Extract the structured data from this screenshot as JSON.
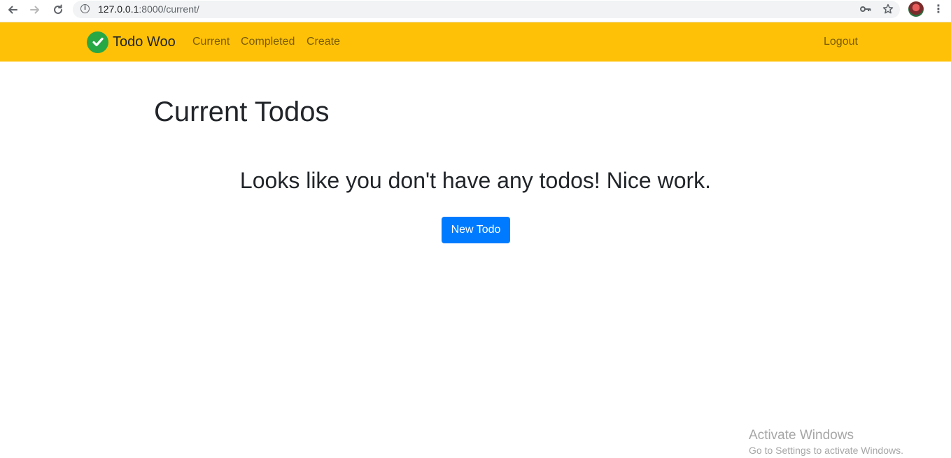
{
  "browser": {
    "url_host": "127.0.0.1",
    "url_rest": ":8000/current/",
    "icons": [
      "back-arrow-icon",
      "forward-arrow-icon",
      "reload-icon",
      "site-info-icon",
      "key-icon",
      "star-icon",
      "profile-avatar",
      "menu-dots-icon"
    ]
  },
  "navbar": {
    "brand": "Todo Woo",
    "links": [
      "Current",
      "Completed",
      "Create"
    ],
    "logout": "Logout",
    "color": "#ffc107"
  },
  "main": {
    "title": "Current Todos",
    "empty_message": "Looks like you don't have any todos! Nice work.",
    "new_todo_button": "New Todo",
    "button_color": "#007bff"
  },
  "watermark": {
    "line1": "Activate Windows",
    "line2": "Go to Settings to activate Windows."
  }
}
